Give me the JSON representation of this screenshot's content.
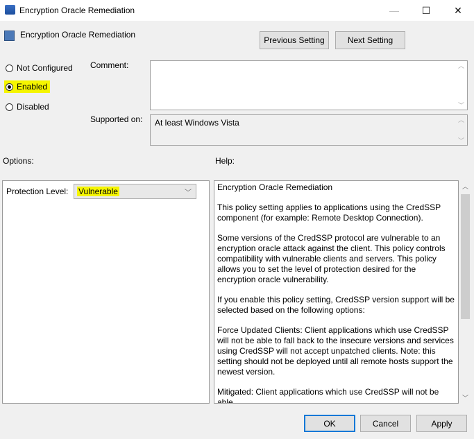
{
  "window": {
    "title": "Encryption Oracle Remediation",
    "minimize": "—",
    "maximize": "☐",
    "close": "✕"
  },
  "header": {
    "setting_name": "Encryption Oracle Remediation",
    "prev_label": "Previous Setting",
    "next_label": "Next Setting"
  },
  "state": {
    "options": [
      {
        "label": "Not Configured",
        "selected": false
      },
      {
        "label": "Enabled",
        "selected": true
      },
      {
        "label": "Disabled",
        "selected": false
      }
    ]
  },
  "comment": {
    "label": "Comment:",
    "value": ""
  },
  "supported": {
    "label": "Supported on:",
    "value": "At least Windows Vista"
  },
  "options_panel": {
    "label": "Options:",
    "protection_label": "Protection Level:",
    "protection_value": "Vulnerable"
  },
  "help": {
    "label": "Help:",
    "paragraphs": [
      "Encryption Oracle Remediation",
      "This policy setting applies to applications using the CredSSP component (for example: Remote Desktop Connection).",
      "Some versions of the CredSSP protocol are vulnerable to an encryption oracle attack against the client.  This policy controls compatibility with vulnerable clients and servers.  This policy allows you to set the level of protection desired for the encryption oracle vulnerability.",
      "If you enable this policy setting, CredSSP version support will be selected based on the following options:",
      "Force Updated Clients: Client applications which use CredSSP will not be able to fall back to the insecure versions and services using CredSSP will not accept unpatched clients. Note: this setting should not be deployed until all remote hosts support the newest version.",
      "Mitigated: Client applications which use CredSSP will not be able"
    ]
  },
  "footer": {
    "ok": "OK",
    "cancel": "Cancel",
    "apply": "Apply"
  }
}
